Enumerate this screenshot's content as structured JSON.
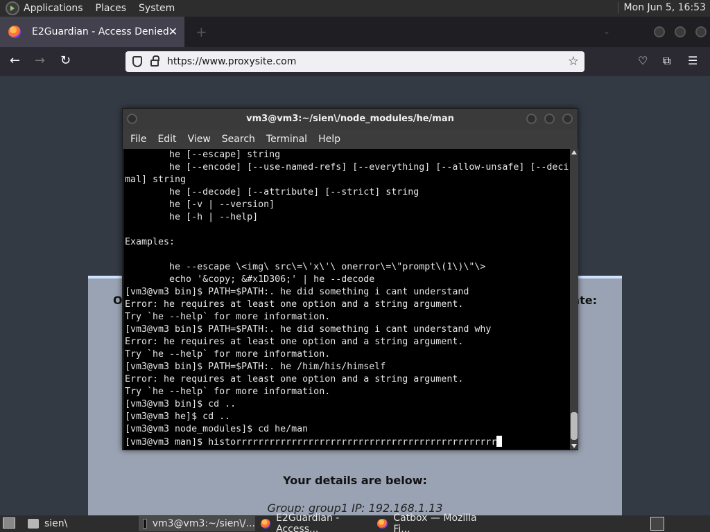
{
  "top_panel": {
    "menus": [
      "Applications",
      "Places",
      "System"
    ],
    "clock": "Mon Jun  5, 16:53"
  },
  "browser": {
    "tab_title": "E2Guardian - Access Denied",
    "url": "https://www.proxysite.com"
  },
  "webpage": {
    "partial_left": "O",
    "partial_right": "ate:",
    "details_heading": "Your details are below:",
    "group_line": "Group: group1   IP: 192.168.1.13"
  },
  "terminal": {
    "title": "vm3@vm3:~/sien\\/node_modules/he/man",
    "menu": [
      "File",
      "Edit",
      "View",
      "Search",
      "Terminal",
      "Help"
    ],
    "lines": [
      "        he [--escape] string",
      "        he [--encode] [--use-named-refs] [--everything] [--allow-unsafe] [--deci",
      "mal] string",
      "        he [--decode] [--attribute] [--strict] string",
      "        he [-v | --version]",
      "        he [-h | --help]",
      "",
      "Examples:",
      "",
      "        he --escape \\<img\\ src\\=\\'x\\'\\ onerror\\=\\\"prompt\\(1\\)\\\"\\>",
      "        echo '&copy; &#x1D306;' | he --decode",
      "[vm3@vm3 bin]$ PATH=$PATH:. he did something i cant understand",
      "Error: he requires at least one option and a string argument.",
      "Try `he --help` for more information.",
      "[vm3@vm3 bin]$ PATH=$PATH:. he did something i cant understand why",
      "Error: he requires at least one option and a string argument.",
      "Try `he --help` for more information.",
      "[vm3@vm3 bin]$ PATH=$PATH:. he /him/his/himself",
      "Error: he requires at least one option and a string argument.",
      "Try `he --help` for more information.",
      "[vm3@vm3 bin]$ cd ..",
      "[vm3@vm3 he]$ cd ..",
      "[vm3@vm3 node_modules]$ cd he/man",
      "[vm3@vm3 man]$ historrrrrrrrrrrrrrrrrrrrrrrrrrrrrrrrrrrrrrrrrrrrrrr"
    ]
  },
  "taskbar": {
    "items": [
      "sien\\",
      "vm3@vm3:~/sien\\/...",
      "E2Guardian - Access...",
      "Catbox — Mozilla Fi..."
    ]
  }
}
